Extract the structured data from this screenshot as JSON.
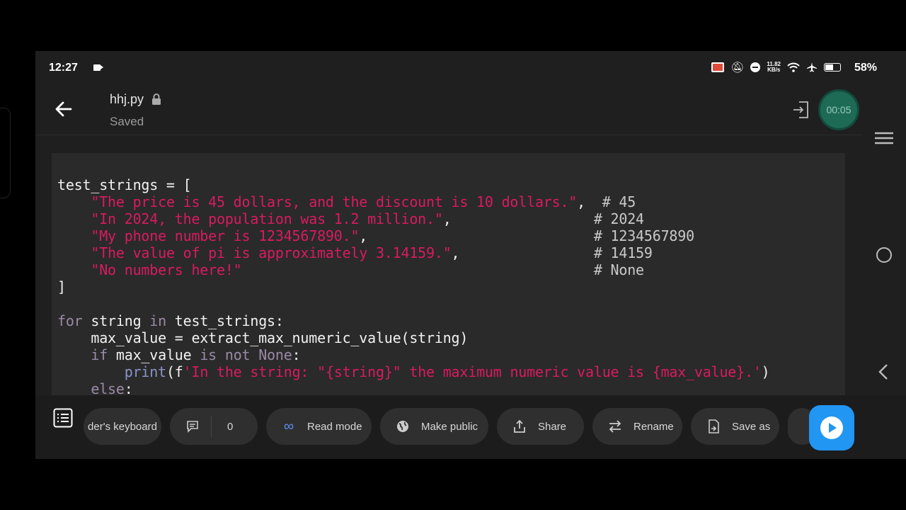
{
  "status_bar": {
    "time": "12:27",
    "speed_top": "11.82",
    "speed_bottom": "KB/s",
    "battery_pct": "58%",
    "battery_level": 0.58,
    "cast_color": "#e04a38"
  },
  "header": {
    "filename": "hhj.py",
    "save_state": "Saved",
    "recording_timer": "00:05"
  },
  "code": {
    "lines": [
      [
        {
          "t": "test_strings = [",
          "c": ""
        }
      ],
      [
        {
          "t": "    ",
          "c": ""
        },
        {
          "t": "\"The price is 45 dollars, and the discount is 10 dollars.\"",
          "c": "str"
        },
        {
          "t": ",  ",
          "c": ""
        },
        {
          "t": "# 45",
          "c": "com"
        }
      ],
      [
        {
          "t": "    ",
          "c": ""
        },
        {
          "t": "\"In 2024, the population was 1.2 million.\"",
          "c": "str"
        },
        {
          "t": ",                 ",
          "c": ""
        },
        {
          "t": "# 2024",
          "c": "com"
        }
      ],
      [
        {
          "t": "    ",
          "c": ""
        },
        {
          "t": "\"My phone number is 1234567890.\"",
          "c": "str"
        },
        {
          "t": ",                           ",
          "c": ""
        },
        {
          "t": "# 1234567890",
          "c": "com"
        }
      ],
      [
        {
          "t": "    ",
          "c": ""
        },
        {
          "t": "\"The value of pi is approximately 3.14159.\"",
          "c": "str"
        },
        {
          "t": ",                ",
          "c": ""
        },
        {
          "t": "# 14159",
          "c": "com"
        }
      ],
      [
        {
          "t": "    ",
          "c": ""
        },
        {
          "t": "\"No numbers here!\"",
          "c": "str"
        },
        {
          "t": "                                          ",
          "c": ""
        },
        {
          "t": "# None",
          "c": "com"
        }
      ],
      [
        {
          "t": "]",
          "c": ""
        }
      ],
      [
        {
          "t": "",
          "c": ""
        }
      ],
      [
        {
          "t": "for",
          "c": "kw"
        },
        {
          "t": " string ",
          "c": ""
        },
        {
          "t": "in",
          "c": "kw"
        },
        {
          "t": " test_strings:",
          "c": ""
        }
      ],
      [
        {
          "t": "    max_value = extract_max_numeric_value(string)",
          "c": ""
        }
      ],
      [
        {
          "t": "    ",
          "c": ""
        },
        {
          "t": "if",
          "c": "kw"
        },
        {
          "t": " max_value ",
          "c": ""
        },
        {
          "t": "is not None",
          "c": "kw"
        },
        {
          "t": ":",
          "c": ""
        }
      ],
      [
        {
          "t": "        ",
          "c": ""
        },
        {
          "t": "print",
          "c": "fn"
        },
        {
          "t": "(f",
          "c": ""
        },
        {
          "t": "'In the string: \"{string}\" the maximum numeric value is {max_value}.'",
          "c": "str"
        },
        {
          "t": ")",
          "c": ""
        }
      ],
      [
        {
          "t": "    ",
          "c": ""
        },
        {
          "t": "else",
          "c": "kw"
        },
        {
          "t": ":",
          "c": ""
        }
      ]
    ]
  },
  "toolbar": {
    "keyboard_label": "der's keyboard",
    "comment_count": "0",
    "read_mode": "Read mode",
    "make_public": "Make public",
    "share": "Share",
    "rename": "Rename",
    "save_as": "Save as"
  },
  "icons": {
    "back": "arrow-left-icon",
    "lock": "lock-icon",
    "exit": "exit-icon",
    "menu": "hamburger-menu-icon",
    "home": "circle-home-icon",
    "nav_back": "chevron-left-icon",
    "keyboard": "list-icon",
    "comment": "comment-icon",
    "read_mode": "infinity-icon",
    "make_public": "globe-icon",
    "share": "share-icon",
    "rename": "swap-icon",
    "save_as": "save-as-icon",
    "run": "play-icon"
  },
  "colors": {
    "string": "#d81b60",
    "keyword": "#9a8aa6",
    "function": "#8a93c9",
    "run_button": "#2196f3",
    "recording": "#1d6a55"
  }
}
